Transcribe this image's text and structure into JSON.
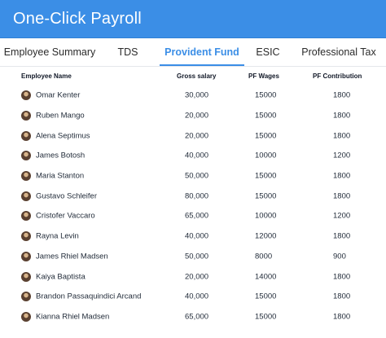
{
  "app": {
    "title": "One-Click Payroll"
  },
  "tabs": [
    {
      "label": "Employee Summary"
    },
    {
      "label": "TDS"
    },
    {
      "label": "Provident Fund"
    },
    {
      "label": "ESIC"
    },
    {
      "label": "Professional Tax"
    }
  ],
  "active_tab": "Provident Fund",
  "colors": {
    "accent": "#3b8ee6"
  },
  "table": {
    "headers": {
      "name": "Employee Name",
      "gross": "Gross salary",
      "wages": "PF Wages",
      "contribution": "PF Contribution"
    },
    "rows": [
      {
        "name": "Omar Kenter",
        "gross": "30,000",
        "wages": "15000",
        "contribution": "1800"
      },
      {
        "name": "Ruben Mango",
        "gross": "20,000",
        "wages": "15000",
        "contribution": "1800"
      },
      {
        "name": "Alena Septimus",
        "gross": "20,000",
        "wages": "15000",
        "contribution": "1800"
      },
      {
        "name": "James Botosh",
        "gross": "40,000",
        "wages": "10000",
        "contribution": "1200"
      },
      {
        "name": "Maria Stanton",
        "gross": "50,000",
        "wages": "15000",
        "contribution": "1800"
      },
      {
        "name": "Gustavo Schleifer",
        "gross": "80,000",
        "wages": "15000",
        "contribution": "1800"
      },
      {
        "name": "Cristofer Vaccaro",
        "gross": "65,000",
        "wages": "10000",
        "contribution": "1200"
      },
      {
        "name": "Rayna Levin",
        "gross": "40,000",
        "wages": "12000",
        "contribution": "1800"
      },
      {
        "name": "James Rhiel Madsen",
        "gross": "50,000",
        "wages": "8000",
        "contribution": "900"
      },
      {
        "name": "Kaiya Baptista",
        "gross": "20,000",
        "wages": "14000",
        "contribution": "1800"
      },
      {
        "name": "Brandon Passaquindici Arcand",
        "gross": "40,000",
        "wages": "15000",
        "contribution": "1800"
      },
      {
        "name": "Kianna Rhiel Madsen",
        "gross": "65,000",
        "wages": "15000",
        "contribution": "1800"
      }
    ]
  }
}
